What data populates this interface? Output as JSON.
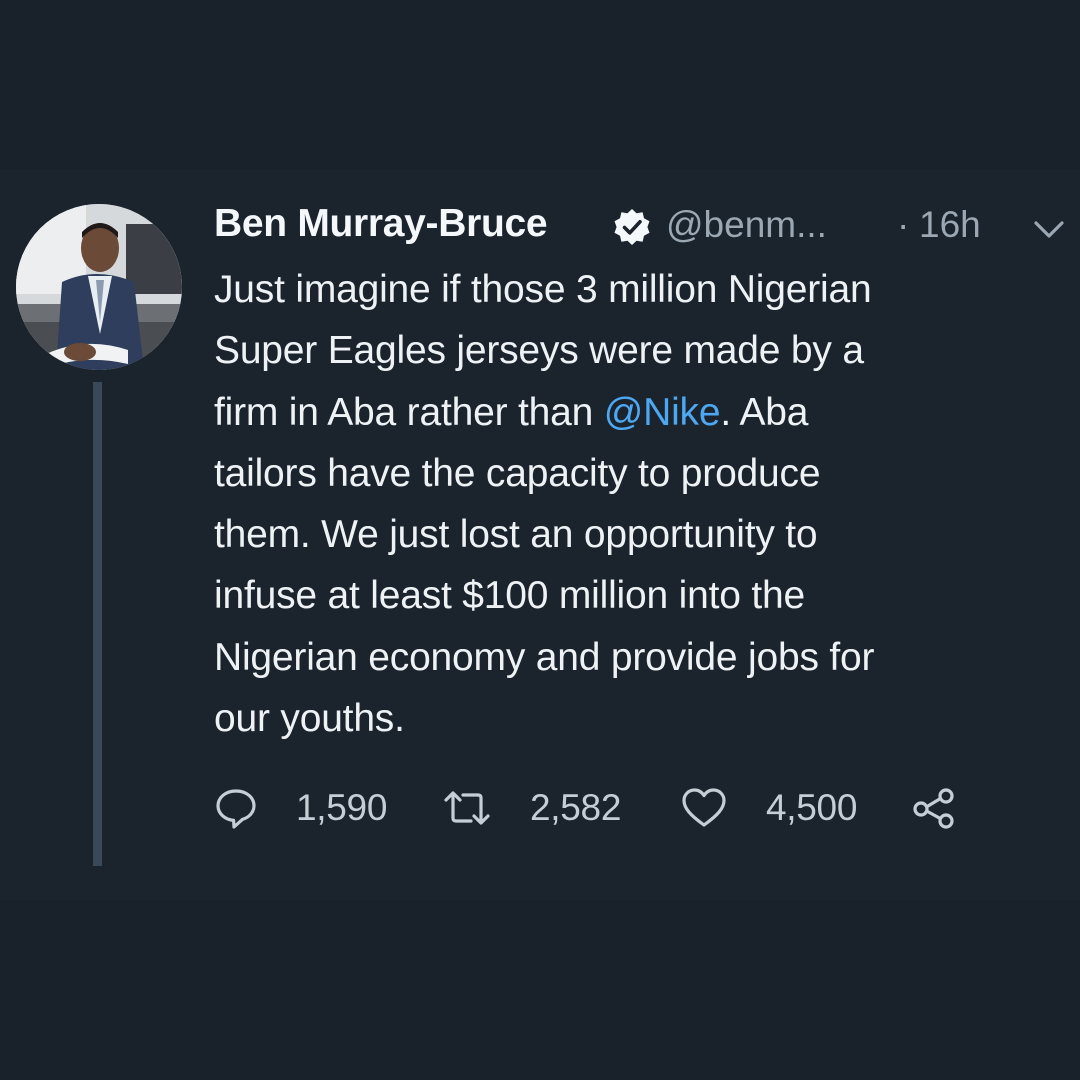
{
  "tweet": {
    "display_name": "Ben Murray-Bruce",
    "handle": "@benm...",
    "separator": "·",
    "time": "16h",
    "text": {
      "line1": "Just imagine if those 3 million Nigerian",
      "line2": "Super Eagles jerseys were made by a",
      "line3_before": "firm in Aba rather than ",
      "line3_mention": "@Nike",
      "line3_after": ". Aba",
      "line4": "tailors have the capacity to produce",
      "line5": "them. We just lost an opportunity to",
      "line6": "infuse at least $100 million into the",
      "line7": "Nigerian economy and provide jobs for",
      "line8": "our youths."
    },
    "actions": {
      "reply_count": "1,590",
      "retweet_count": "2,582",
      "like_count": "4,500"
    }
  },
  "icons": {
    "verified": "verified-badge-icon",
    "caret": "chevron-down-icon",
    "reply": "reply-icon",
    "retweet": "retweet-icon",
    "like": "heart-icon",
    "share": "share-icon"
  },
  "colors": {
    "background": "#1b232c",
    "mention": "#4ea7f1",
    "secondary_text": "#9ba8b4",
    "thread_line": "#3a4958"
  }
}
